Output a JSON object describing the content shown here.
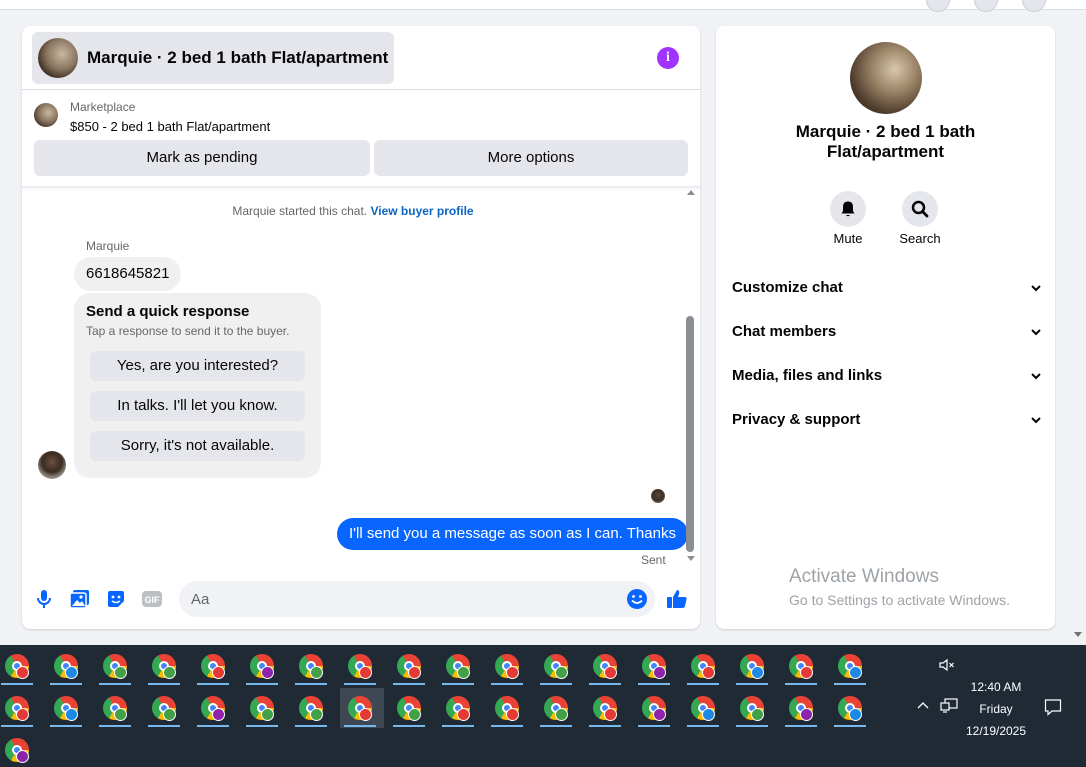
{
  "chat": {
    "title": "Marquie · 2 bed 1 bath Flat/apartment",
    "listing_source": "Marketplace",
    "listing_price_title": "$850 - 2 bed 1 bath Flat/apartment",
    "mark_pending_label": "Mark as pending",
    "more_options_label": "More options",
    "started_text": "Marquie started this chat. ",
    "view_profile_label": "View buyer profile",
    "sender_name": "Marquie",
    "incoming_message": "6618645821",
    "quick_title": "Send a quick response",
    "quick_subtitle": "Tap a response to send it to the buyer.",
    "quick_responses": [
      "Yes, are you interested?",
      "In talks. I'll let you know.",
      "Sorry, it's not available."
    ],
    "outgoing_message": "I'll send you a message as soon as I can. Thanks",
    "sent_label": "Sent",
    "input_placeholder": "Aa"
  },
  "info_panel": {
    "title": "Marquie · 2 bed 1 bath Flat/apartment",
    "mute_label": "Mute",
    "search_label": "Search",
    "sections": [
      "Customize chat",
      "Chat members",
      "Media, files and links",
      "Privacy & support"
    ]
  },
  "watermark": {
    "line1": "Activate Windows",
    "line2": "Go to Settings to activate Windows."
  },
  "taskbar": {
    "time": "12:40 AM",
    "day": "Friday",
    "date": "12/19/2025",
    "profile_colors": [
      "#e53935",
      "#1e88e5",
      "#43a047",
      "#43a047",
      "#e53935",
      "#8e24aa",
      "#43a047",
      "#e53935",
      "#e53935",
      "#43a047",
      "#e53935",
      "#43a047",
      "#e53935",
      "#8e24aa",
      "#e53935",
      "#1e88e5",
      "#e53935",
      "#1e88e5",
      "#e53935",
      "#1e88e5",
      "#43a047",
      "#43a047",
      "#8e24aa",
      "#43a047",
      "#43a047",
      "#e53935",
      "#43a047",
      "#e53935",
      "#e53935",
      "#43a047",
      "#e53935",
      "#8e24aa",
      "#1e88e5",
      "#43a047",
      "#8e24aa",
      "#1e88e5",
      "#8e24aa"
    ],
    "active_index": 25
  },
  "colors": {
    "accent_blue": "#0866ff",
    "info_purple": "#a033ff",
    "link_blue": "#0a66c2"
  }
}
